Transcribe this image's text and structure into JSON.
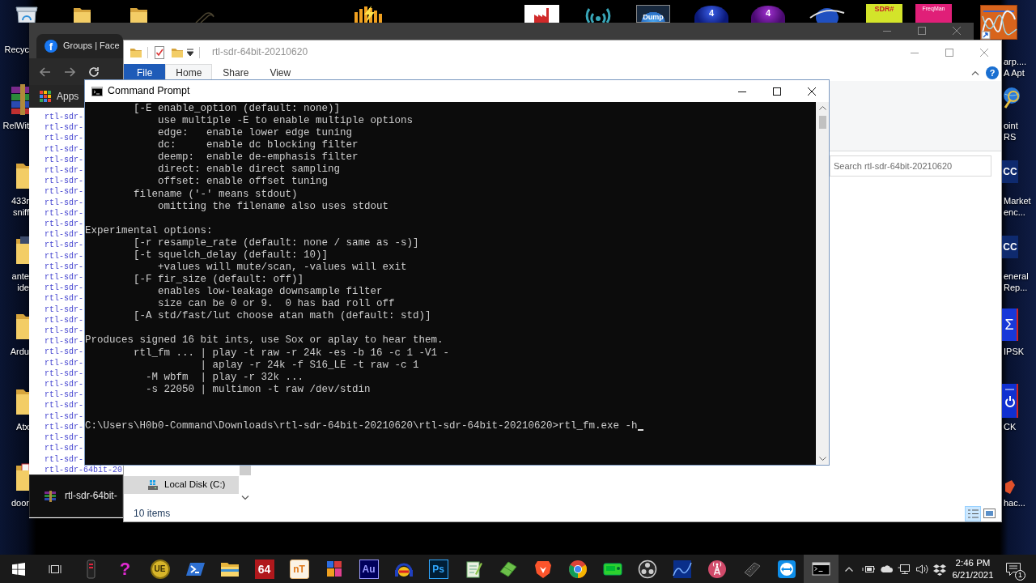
{
  "desktop": {
    "top_icons": [
      {
        "selected": false,
        "label": [
          "Recyc"
        ]
      },
      {
        "selected": false
      },
      {
        "selected": false
      },
      {
        "selected": false
      },
      {
        "selected": false
      },
      {
        "selected": false
      },
      {
        "selected": false
      },
      {
        "selected": false,
        "glyph": "Dump"
      },
      {
        "selected": false,
        "glyph": "4"
      },
      {
        "selected": false,
        "glyph": "4"
      },
      {
        "selected": false
      },
      {
        "selected": false,
        "glyph": "SDR#"
      },
      {
        "selected": false,
        "glyph": "FreqMan"
      },
      {
        "selected": false,
        "label": [
          "arp....",
          "A Apt"
        ]
      }
    ],
    "left_icons": [
      {
        "selected": false,
        "label": [
          "RelWit"
        ]
      },
      {
        "selected": false,
        "label": [
          "433r",
          "sniff"
        ]
      },
      {
        "selected": false,
        "label": [
          "ante",
          "ide"
        ]
      },
      {
        "selected": false,
        "label": [
          "Ardu"
        ]
      },
      {
        "selected": false,
        "label": [
          "Atx"
        ]
      },
      {
        "selected": false,
        "label": [
          "door"
        ]
      }
    ],
    "right_icons": [
      {
        "selected": false,
        "label": [
          "oint",
          "RS"
        ]
      },
      {
        "selected": false,
        "glyph": "CC",
        "label": [
          "Market",
          "enc..."
        ]
      },
      {
        "selected": false,
        "glyph": "CC",
        "label": [
          "eneral",
          "Rep..."
        ]
      },
      {
        "selected": false,
        "glyph": "Σ",
        "label": [
          "IPSK"
        ]
      },
      {
        "selected": false,
        "label": [
          "CK"
        ]
      },
      {
        "selected": false,
        "label": [
          "hac..."
        ]
      }
    ]
  },
  "browser": {
    "tabs": [
      {
        "favicon": "f",
        "title": "Groups | Face",
        "selected": true
      }
    ],
    "bookmarks": [
      "Apps"
    ],
    "links": [
      "rtl-sdr-",
      "rtl-sdr-",
      "rtl-sdr-",
      "rtl-sdr-",
      "rtl-sdr-",
      "rtl-sdr-",
      "rtl-sdr-",
      "rtl-sdr-",
      "rtl-sdr-",
      "rtl-sdr-",
      "rtl-sdr-",
      "rtl-sdr-",
      "rtl-sdr-",
      "rtl-sdr-",
      "rtl-sdr-",
      "rtl-sdr-",
      "rtl-sdr-",
      "rtl-sdr-",
      "rtl-sdr-",
      "rtl-sdr-",
      "rtl-sdr-",
      "rtl-sdr-",
      "rtl-sdr-",
      "rtl-sdr-",
      "rtl-sdr-",
      "rtl-sdr-",
      "rtl-sdr-",
      "rtl-sdr-",
      "rtl-sdr-",
      "rtl-sdr-",
      "rtl-sdr-",
      "rtl-sdr-",
      "rtl-sdr-",
      "rtl-sdr-64bit-20"
    ]
  },
  "taskbar_preview": {
    "title": "rtl-sdr-64bit-"
  },
  "explorer": {
    "title": "rtl-sdr-64bit-20210620",
    "ribbon_tabs": [
      {
        "kind": "menu",
        "label": "File",
        "selected": false
      },
      {
        "kind": "tab",
        "label": "Home",
        "selected": true
      },
      {
        "kind": "tab",
        "label": "Share",
        "selected": false
      },
      {
        "kind": "tab",
        "label": "View",
        "selected": false
      }
    ],
    "help": "?",
    "search": {
      "placeholder": "Search rtl-sdr-64bit-20210620"
    },
    "nav_items": [
      {
        "label": "Local Disk (C:)",
        "selected": true
      }
    ],
    "status": "10 items",
    "views": [
      {
        "selected": true
      },
      {
        "selected": false
      }
    ]
  },
  "console": {
    "title": "Command Prompt",
    "output": [
      [
        "        [-E enable_option (default: none)]",
        "            use multiple -E to enable multiple options",
        "            edge:   enable lower edge tuning",
        "            dc:     enable dc blocking filter",
        "            deemp:  enable de-emphasis filter",
        "            direct: enable direct sampling",
        "            offset: enable offset tuning",
        "        filename ('-' means stdout)",
        "            omitting the filename also uses stdout"
      ],
      [
        "Experimental options:",
        "        [-r resample_rate (default: none / same as -s)]",
        "        [-t squelch_delay (default: 10)]",
        "            +values will mute/scan, -values will exit",
        "        [-F fir_size (default: off)]",
        "            enables low-leakage downsample filter",
        "            size can be 0 or 9.  0 has bad roll off",
        "        [-A std/fast/lut choose atan math (default: std)]"
      ],
      [
        "Produces signed 16 bit ints, use Sox or aplay to hear them.",
        "        rtl_fm ... | play -t raw -r 24k -es -b 16 -c 1 -V1 -",
        "                   | aplay -r 24k -f S16_LE -t raw -c 1",
        "          -M wbfm  | play -r 32k ...",
        "          -s 22050 | multimon -t raw /dev/stdin"
      ]
    ],
    "prompt": "C:\\Users\\H0b0-Command\\Downloads\\rtl-sdr-64bit-20210620\\rtl-sdr-64bit-20210620>rtl_fm.exe -h"
  },
  "taskbar": {
    "apps": [
      {
        "active": false
      },
      {
        "active": false,
        "glyph": "?"
      },
      {
        "active": false,
        "glyph": "UE"
      },
      {
        "active": false
      },
      {
        "active": false
      },
      {
        "active": false,
        "glyph": "64"
      },
      {
        "active": false,
        "glyph": "nT"
      },
      {
        "active": false
      },
      {
        "active": false,
        "glyph": "Au"
      },
      {
        "active": false
      },
      {
        "active": false,
        "glyph": "Ps"
      },
      {
        "active": false
      },
      {
        "active": false
      },
      {
        "active": false
      },
      {
        "active": false
      },
      {
        "active": false
      },
      {
        "active": false
      },
      {
        "active": false
      },
      {
        "active": false
      },
      {
        "active": false
      },
      {
        "active": false
      },
      {
        "active": true
      }
    ],
    "clock": {
      "time": "2:46 PM",
      "date": "6/21/2021"
    },
    "notification_count": "1"
  }
}
